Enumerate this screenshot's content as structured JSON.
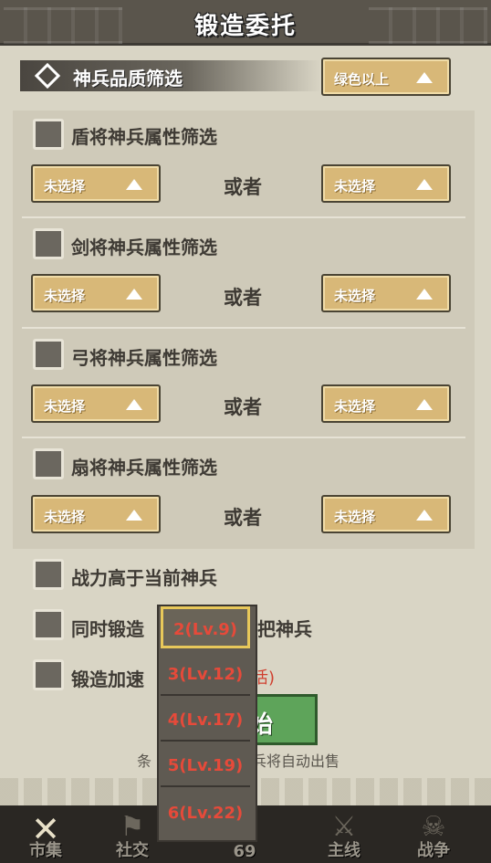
{
  "header": {
    "title": "锻造委托"
  },
  "quality_filter": {
    "label": "神兵品质筛选",
    "value": "绿色以上"
  },
  "filters": [
    {
      "label": "盾将神兵属性筛选",
      "left": "未选择",
      "or": "或者",
      "right": "未选择"
    },
    {
      "label": "剑将神兵属性筛选",
      "left": "未选择",
      "or": "或者",
      "right": "未选择"
    },
    {
      "label": "弓将神兵属性筛选",
      "left": "未选择",
      "or": "或者",
      "right": "未选择"
    },
    {
      "label": "扇将神兵属性筛选",
      "left": "未选择",
      "or": "或者",
      "right": "未选择"
    }
  ],
  "options": {
    "power_higher": "战力高于当前神兵",
    "simultaneous_prefix": "同时锻造",
    "simultaneous_suffix": "把神兵",
    "accelerate": "锻造加速",
    "accelerate_hint": "活)"
  },
  "start_button": {
    "label": "始"
  },
  "note": {
    "left": "条",
    "right": "兵将自动出售"
  },
  "count_popup": {
    "options": [
      "2(Lv.9)",
      "3(Lv.12)",
      "4(Lv.17)",
      "5(Lv.19)",
      "6(Lv.22)"
    ],
    "selected_index": 0
  },
  "bottom_nav": {
    "items": [
      {
        "label": "市集",
        "icon": "close-x-icon"
      },
      {
        "label": "社交",
        "icon": "social-icon"
      },
      {
        "label": "69",
        "icon": "brush-icon"
      },
      {
        "label": "主线",
        "icon": "crossed-swords-icon"
      },
      {
        "label": "战争",
        "icon": "war-icon"
      }
    ]
  },
  "colors": {
    "accent_gold": "#d8b878",
    "hint_red": "#e64a3a",
    "start_green": "#5ea45a"
  }
}
